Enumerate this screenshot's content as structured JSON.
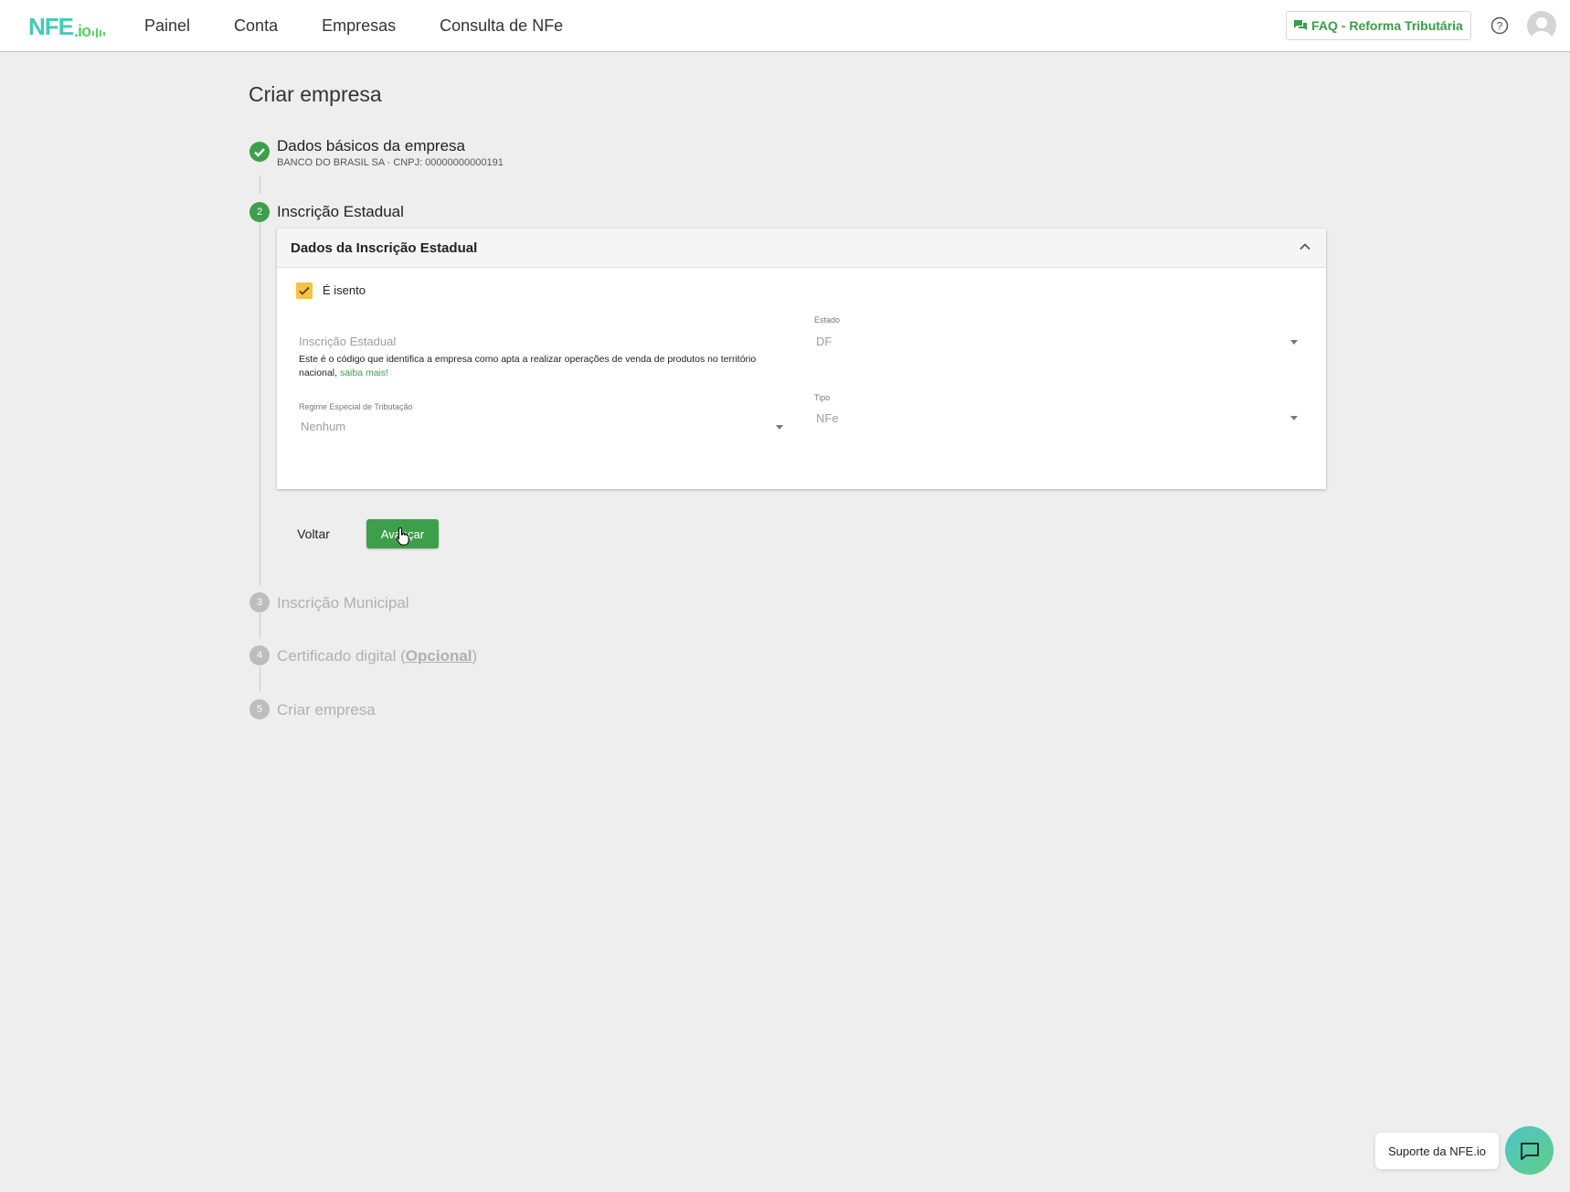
{
  "header": {
    "logo_main": "NFE",
    "logo_suffix": ".io",
    "nav": [
      "Painel",
      "Conta",
      "Empresas",
      "Consulta de NFe"
    ],
    "faq_label": "FAQ - Reforma Tributária",
    "icons": {
      "faq": "chat-icon",
      "help": "help-circle-icon",
      "avatar": "user-avatar-icon"
    },
    "accent_color": "#3d9f4a"
  },
  "page": {
    "title": "Criar empresa"
  },
  "steps": [
    {
      "number": "1",
      "title": "Dados básicos da empresa",
      "subtitle": "BANCO DO BRASIL SA · CNPJ: 00000000000191",
      "status": "done"
    },
    {
      "number": "2",
      "title": "Inscrição Estadual",
      "status": "active"
    },
    {
      "number": "3",
      "title": "Inscrição Municipal",
      "status": "pending"
    },
    {
      "number": "4",
      "title_prefix": "Certificado digital (",
      "title_link": "Opcional",
      "title_suffix": ")",
      "status": "pending"
    },
    {
      "number": "5",
      "title": "Criar empresa",
      "status": "pending"
    }
  ],
  "card": {
    "title": "Dados da Inscrição Estadual",
    "exempt_label": "É isento",
    "exempt_checked": true,
    "ie_placeholder": "Inscrição Estadual",
    "helper_text": "Este é o código que identifica a empresa como apta a realizar operações de venda de produtos no território nacional, ",
    "helper_link": "saiba mais!",
    "estado_label": "Estado",
    "estado_value": "DF",
    "regime_label": "Regime Especial de Tributação",
    "regime_value": "Nenhum",
    "tipo_label": "Tipo",
    "tipo_value": "NFe"
  },
  "actions": {
    "back": "Voltar",
    "next": "Avançar"
  },
  "support": {
    "label": "Suporte da NFE.io",
    "icon": "chat-bubble-icon"
  }
}
